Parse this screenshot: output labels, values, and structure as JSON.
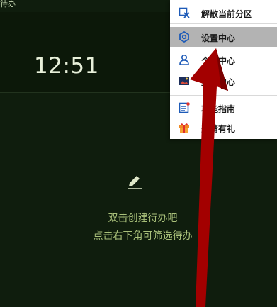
{
  "top": {
    "partial_text": "待办"
  },
  "clock": {
    "time": "12:51"
  },
  "empty_state": {
    "line1": "双击创建待办吧",
    "line2": "点击右下角可筛选待办"
  },
  "menu": {
    "items": [
      {
        "label": "解散当前分区",
        "icon": "unlink-icon"
      },
      {
        "label": "设置中心",
        "icon": "gear-icon"
      },
      {
        "label": "个人中心",
        "icon": "user-icon"
      },
      {
        "label": "壁纸中心",
        "icon": "image-icon"
      },
      {
        "label": "功能指南",
        "icon": "guide-icon"
      },
      {
        "label": "邀请有礼",
        "icon": "gift-icon"
      }
    ]
  },
  "colors": {
    "background": "#0f1d0d",
    "menu_highlight": "#b3b3b3",
    "arrow": "#a30000",
    "hint_text": "#a9c07a",
    "accent_blue": "#1e5bb8"
  }
}
